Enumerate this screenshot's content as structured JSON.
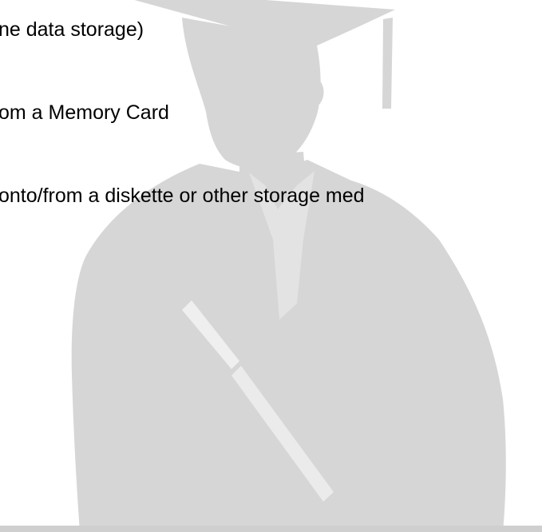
{
  "slide": {
    "lines": [
      "ne data storage)",
      "om a Memory Card",
      "onto/from a diskette or other storage med"
    ]
  },
  "colors": {
    "background": "#ffffff",
    "silhouette": "#d6d6d6",
    "text": "#000000"
  }
}
